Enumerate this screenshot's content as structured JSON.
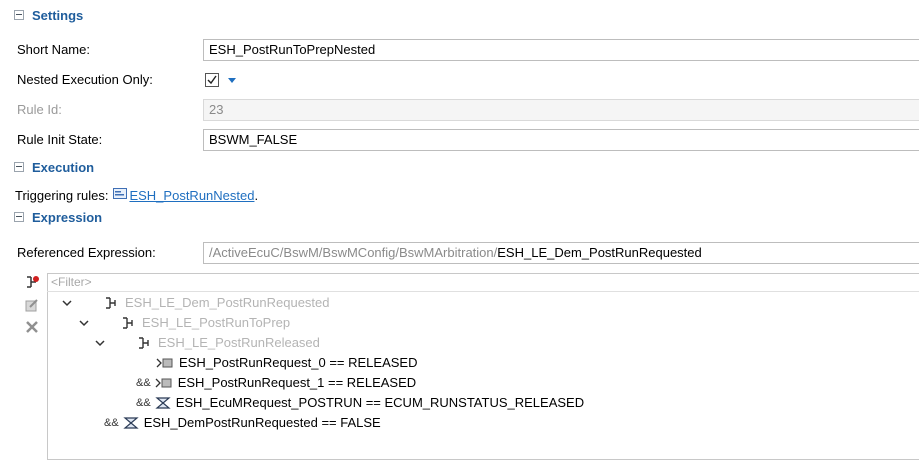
{
  "sections": {
    "settings": "Settings",
    "execution": "Execution",
    "expression": "Expression"
  },
  "settings": {
    "short_name_label": "Short Name:",
    "short_name_value": "ESH_PostRunToPrepNested",
    "nested_label": "Nested Execution Only:",
    "nested_checked": true,
    "rule_id_label": "Rule Id:",
    "rule_id_value": "23",
    "init_state_label": "Rule Init State:",
    "init_state_value": "BSWM_FALSE"
  },
  "execution": {
    "triggering_label": "Triggering rules:",
    "triggering_link": " ESH_PostRunNested",
    "triggering_suffix": "."
  },
  "expression": {
    "ref_label": "Referenced Expression:",
    "ref_path_prefix": "/ActiveEcuC/BswM/BswMConfig/BswMArbitration/",
    "ref_path_name": "ESH_LE_Dem_PostRunRequested",
    "filter_placeholder": "<Filter>"
  },
  "tree": [
    {
      "op": "",
      "icon": "logical-expression-icon",
      "text": "ESH_LE_Dem_PostRunRequested",
      "state": "disabled",
      "expanded": true
    },
    {
      "op": "",
      "icon": "logical-expression-icon",
      "text": "ESH_LE_PostRunToPrep",
      "state": "disabled",
      "expanded": true
    },
    {
      "op": "",
      "icon": "logical-expression-icon",
      "text": "ESH_LE_PostRunReleased",
      "state": "disabled",
      "expanded": true
    },
    {
      "op": "",
      "icon": "mode-condition-icon",
      "text": "ESH_PostRunRequest_0 == RELEASED",
      "state": "normal"
    },
    {
      "op": "&&",
      "icon": "mode-condition-icon",
      "text": "ESH_PostRunRequest_1 == RELEASED",
      "state": "normal"
    },
    {
      "op": "&&",
      "icon": "ecum-condition-icon",
      "text": "ESH_EcuMRequest_POSTRUN == ECUM_RUNSTATUS_RELEASED",
      "state": "normal"
    },
    {
      "op": "&&",
      "icon": "ecum-condition-icon",
      "text": "ESH_DemPostRunRequested == FALSE",
      "state": "normal"
    }
  ],
  "colors": {
    "section_title": "#1f5d9c",
    "link": "#1f6fc0",
    "disabled_text": "#b4b4b4"
  }
}
